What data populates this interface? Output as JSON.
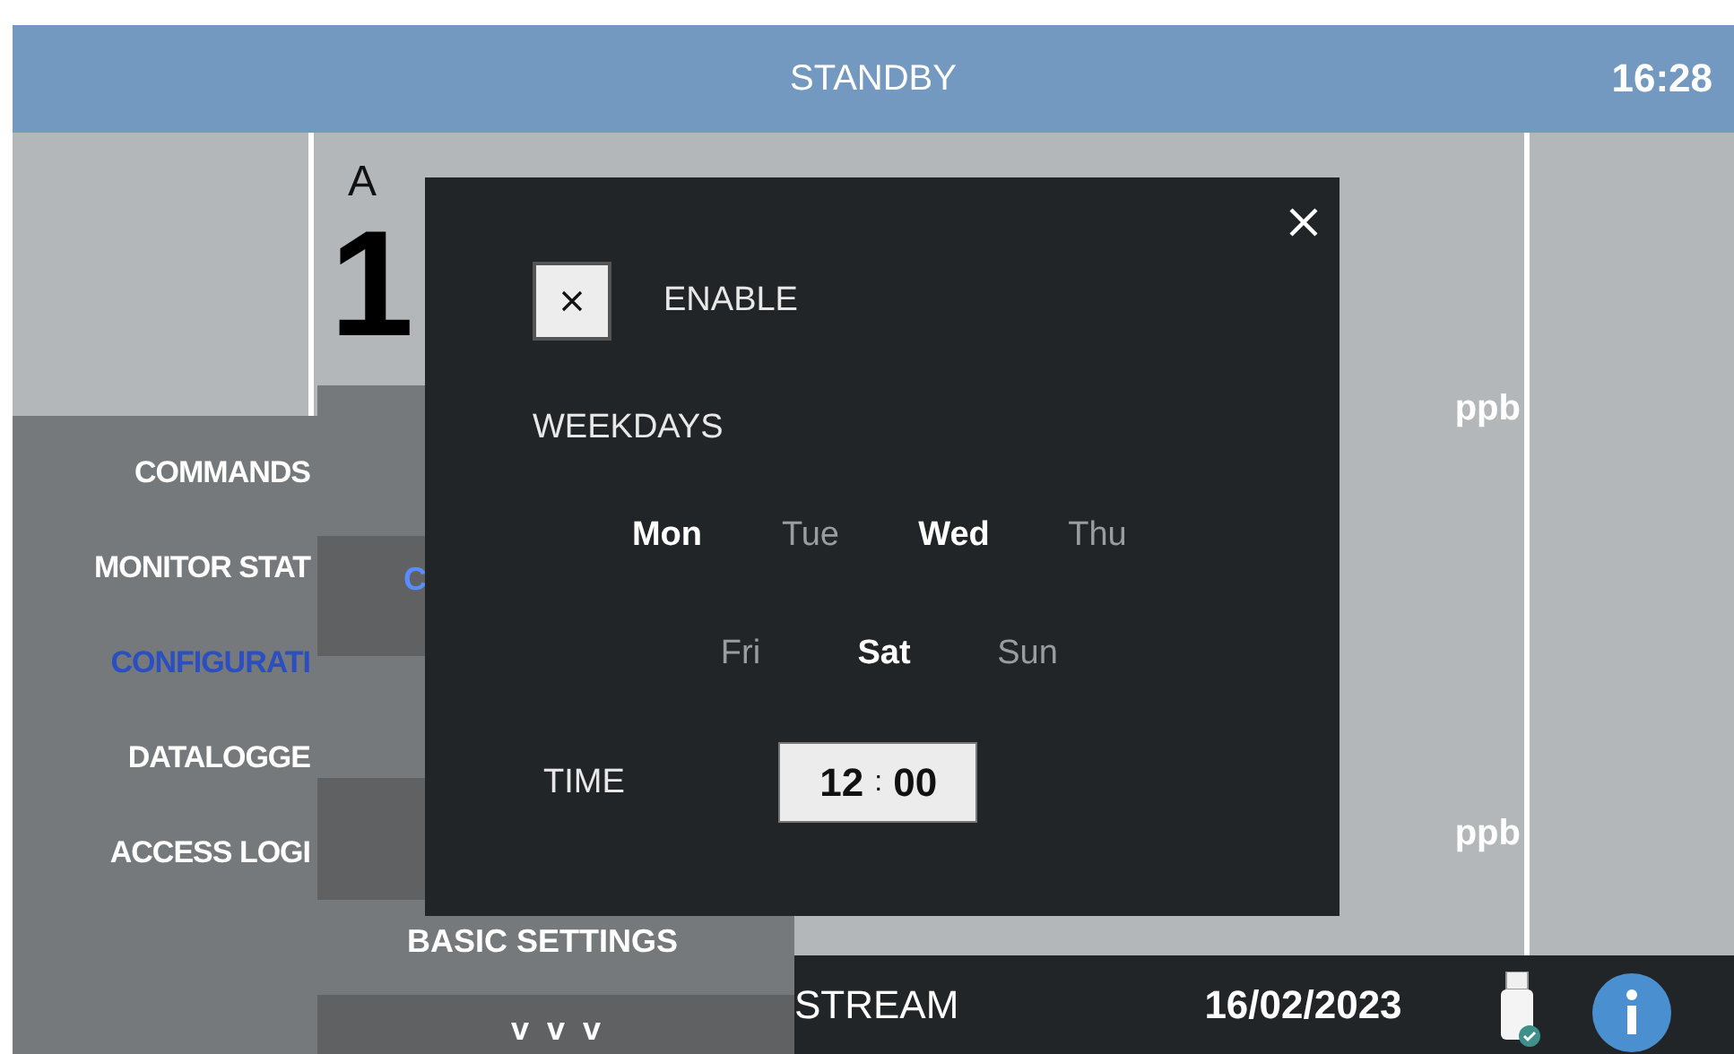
{
  "header": {
    "status": "STANDBY",
    "time": "16:28"
  },
  "main": {
    "label": "A",
    "value": "1",
    "units": [
      "ppb",
      "ppb"
    ]
  },
  "sidebar": {
    "items": [
      {
        "label": "COMMANDS",
        "selected": false
      },
      {
        "label": "MONITOR STAT",
        "selected": false
      },
      {
        "label": "CONFIGURATI",
        "selected": true
      },
      {
        "label": "DATALOGGE",
        "selected": false
      },
      {
        "label": "ACCESS LOGI",
        "selected": false
      }
    ]
  },
  "submenu": {
    "items": [
      {
        "label": "C",
        "selected": true
      }
    ],
    "basic_settings": "BASIC SETTINGS",
    "more": "v  v  v"
  },
  "dialog": {
    "enable": {
      "label": "ENABLE",
      "checked": true
    },
    "weekdays_label": "WEEKDAYS",
    "days": [
      {
        "label": "Mon",
        "selected": true
      },
      {
        "label": "Tue",
        "selected": false
      },
      {
        "label": "Wed",
        "selected": true
      },
      {
        "label": "Thu",
        "selected": false
      },
      {
        "label": "Fri",
        "selected": false
      },
      {
        "label": "Sat",
        "selected": true
      },
      {
        "label": "Sun",
        "selected": false
      }
    ],
    "time_label": "TIME",
    "time": {
      "hours": "12",
      "separator": ":",
      "minutes": "00"
    }
  },
  "status_bar": {
    "mode": "STREAM",
    "date": "16/02/2023"
  }
}
